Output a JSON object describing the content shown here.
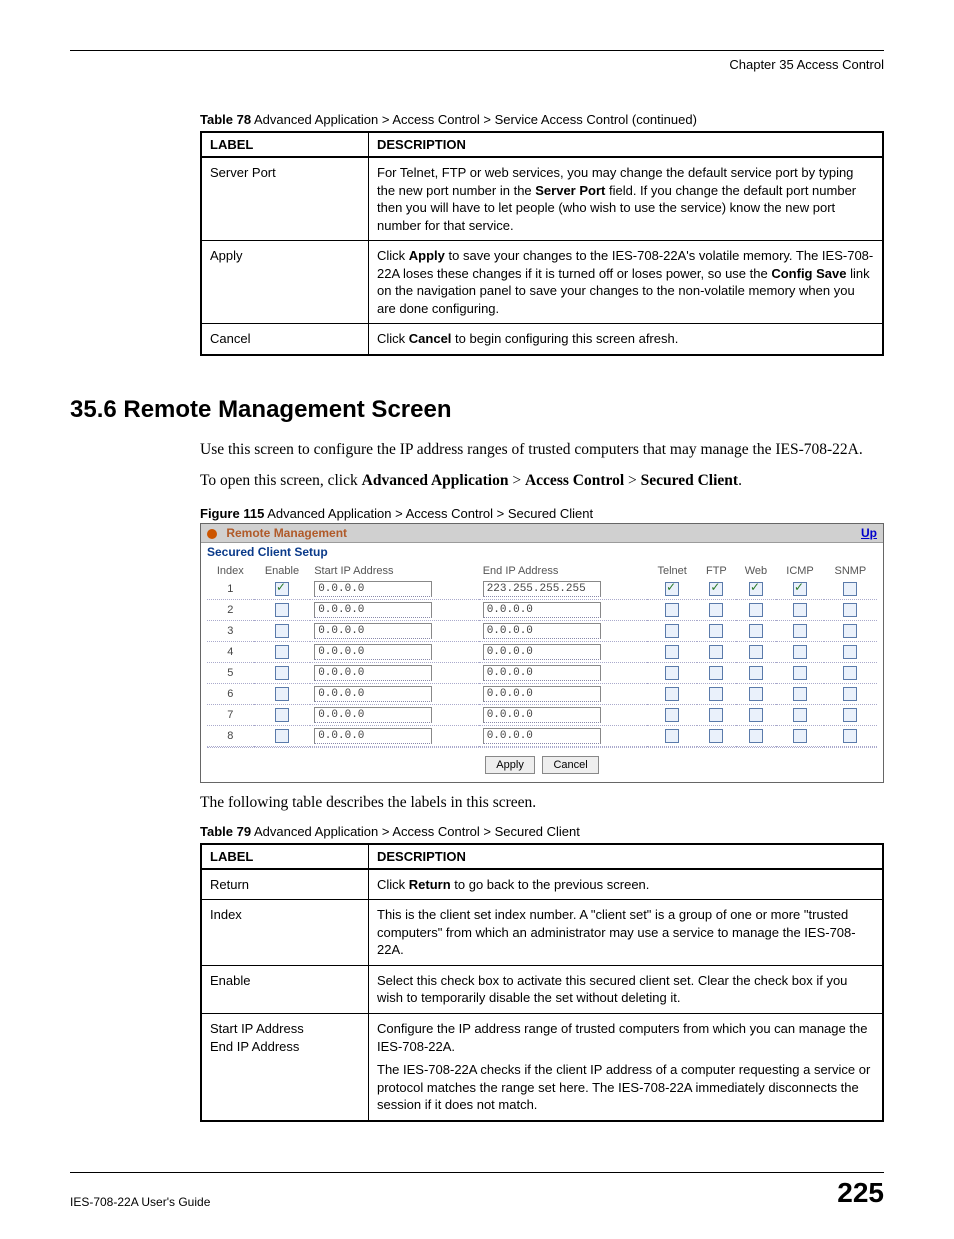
{
  "header": {
    "chapter": "Chapter 35 Access Control"
  },
  "table78": {
    "caption_bold": "Table 78",
    "caption_rest": "   Advanced Application > Access Control > Service Access Control (continued)",
    "head_label": "LABEL",
    "head_desc": "DESCRIPTION",
    "rows": [
      {
        "label": "Server Port",
        "desc_pre": "For Telnet, FTP or web services, you may change the default service port by typing the new port number in the ",
        "desc_b1": "Server Port",
        "desc_post": " field. If you change the default port number then you will have to let people (who wish to use the service) know the new port number for that service."
      },
      {
        "label": "Apply",
        "desc_pre": "Click ",
        "desc_b1": "Apply",
        "desc_mid": " to save your changes to the IES-708-22A's volatile memory. The IES-708-22A loses these changes if it is turned off or loses power, so use the ",
        "desc_b2": "Config Save",
        "desc_post": " link on the navigation panel to save your changes to the non-volatile memory when you are done configuring."
      },
      {
        "label": "Cancel",
        "desc_pre": "Click ",
        "desc_b1": "Cancel",
        "desc_post": " to begin configuring this screen afresh."
      }
    ]
  },
  "section": {
    "heading": "35.6  Remote Management Screen",
    "para1": "Use this screen to configure the IP address ranges of trusted computers that may manage the IES-708-22A.",
    "para2_pre": "To open this screen, click ",
    "para2_b1": "Advanced Application",
    "para2_sep1": " > ",
    "para2_b2": "Access Control",
    "para2_sep2": " > ",
    "para2_b3": "Secured Client",
    "para2_post": "."
  },
  "figure": {
    "caption_bold": "Figure 115",
    "caption_rest": "   Advanced Application > Access Control > Secured Client",
    "title": "Remote Management",
    "up": "Up",
    "subtitle": "Secured Client Setup",
    "cols": {
      "index": "Index",
      "enable": "Enable",
      "start": "Start IP Address",
      "end": "End IP Address",
      "telnet": "Telnet",
      "ftp": "FTP",
      "web": "Web",
      "icmp": "ICMP",
      "snmp": "SNMP"
    },
    "rows": [
      {
        "idx": "1",
        "enable": true,
        "start": "0.0.0.0",
        "end": "223.255.255.255",
        "telnet": true,
        "ftp": true,
        "web": true,
        "icmp": true,
        "snmp": false
      },
      {
        "idx": "2",
        "enable": false,
        "start": "0.0.0.0",
        "end": "0.0.0.0",
        "telnet": false,
        "ftp": false,
        "web": false,
        "icmp": false,
        "snmp": false
      },
      {
        "idx": "3",
        "enable": false,
        "start": "0.0.0.0",
        "end": "0.0.0.0",
        "telnet": false,
        "ftp": false,
        "web": false,
        "icmp": false,
        "snmp": false
      },
      {
        "idx": "4",
        "enable": false,
        "start": "0.0.0.0",
        "end": "0.0.0.0",
        "telnet": false,
        "ftp": false,
        "web": false,
        "icmp": false,
        "snmp": false
      },
      {
        "idx": "5",
        "enable": false,
        "start": "0.0.0.0",
        "end": "0.0.0.0",
        "telnet": false,
        "ftp": false,
        "web": false,
        "icmp": false,
        "snmp": false
      },
      {
        "idx": "6",
        "enable": false,
        "start": "0.0.0.0",
        "end": "0.0.0.0",
        "telnet": false,
        "ftp": false,
        "web": false,
        "icmp": false,
        "snmp": false
      },
      {
        "idx": "7",
        "enable": false,
        "start": "0.0.0.0",
        "end": "0.0.0.0",
        "telnet": false,
        "ftp": false,
        "web": false,
        "icmp": false,
        "snmp": false
      },
      {
        "idx": "8",
        "enable": false,
        "start": "0.0.0.0",
        "end": "0.0.0.0",
        "telnet": false,
        "ftp": false,
        "web": false,
        "icmp": false,
        "snmp": false
      }
    ],
    "apply": "Apply",
    "cancel": "Cancel"
  },
  "after_figure": "The following table describes the labels in this screen.",
  "table79": {
    "caption_bold": "Table 79",
    "caption_rest": "   Advanced Application > Access Control > Secured Client",
    "head_label": "LABEL",
    "head_desc": "DESCRIPTION",
    "rows": [
      {
        "label": "Return",
        "desc_pre": "Click ",
        "desc_b1": "Return",
        "desc_post": " to go back to the previous screen."
      },
      {
        "label": "Index",
        "desc": "This is the client set index number. A \"client set\" is a group of one or more \"trusted computers\" from which an administrator may use a service to manage the IES-708-22A."
      },
      {
        "label": "Enable",
        "desc": "Select this check box to activate this secured client set. Clear the check box if you wish to temporarily disable the set without deleting it."
      },
      {
        "label": "Start IP Address\nEnd IP Address",
        "desc_p1": "Configure the IP address range of trusted computers from which you can manage the IES-708-22A.",
        "desc_p2": "The IES-708-22A checks if the client IP address of a computer requesting a service or protocol matches the range set here. The IES-708-22A immediately disconnects the session if it does not match."
      }
    ]
  },
  "footer": {
    "guide": "IES-708-22A User's Guide",
    "page": "225"
  }
}
